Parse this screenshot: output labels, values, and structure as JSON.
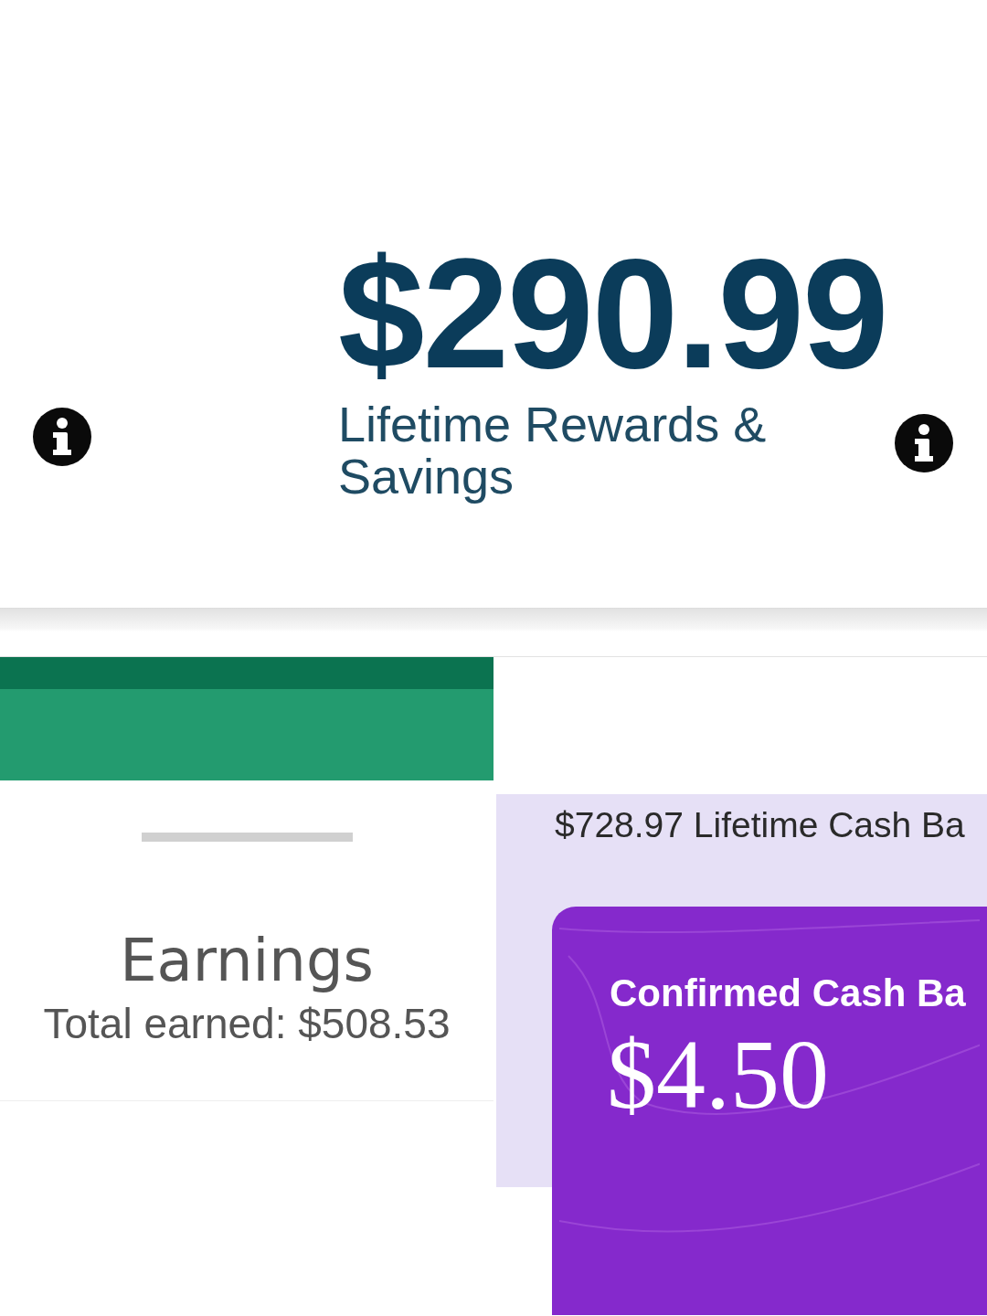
{
  "rewards": {
    "amount": "$290.99",
    "label": "Lifetime Rewards & Savings"
  },
  "earnings": {
    "title": "Earnings",
    "total": "Total earned: $508.53"
  },
  "cash_back": {
    "lifetime": "$728.97 Lifetime Cash Ba",
    "card": {
      "title": "Confirmed Cash Ba",
      "amount": "$4.50"
    }
  }
}
